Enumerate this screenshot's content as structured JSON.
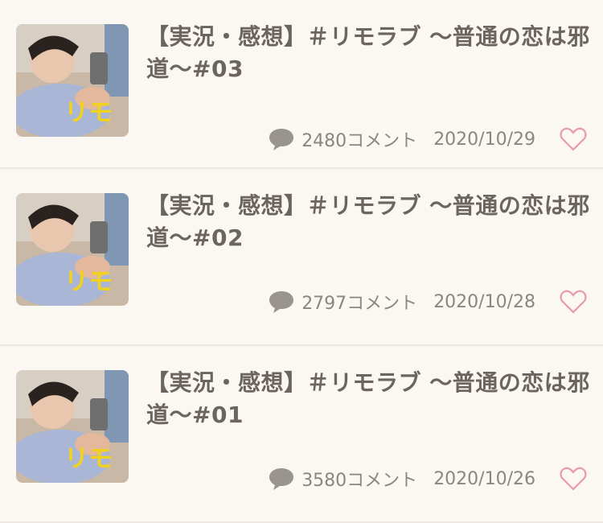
{
  "articles": [
    {
      "title": "【実況・感想】＃リモラブ 〜普通の恋は邪道〜#03",
      "comments": "2480コメント",
      "date": "2020/10/29",
      "thumb_text": "リモ"
    },
    {
      "title": "【実況・感想】＃リモラブ 〜普通の恋は邪道〜#02",
      "comments": "2797コメント",
      "date": "2020/10/28",
      "thumb_text": "リモ"
    },
    {
      "title": "【実況・感想】＃リモラブ 〜普通の恋は邪道〜#01",
      "comments": "3580コメント",
      "date": "2020/10/26",
      "thumb_text": "リモ"
    }
  ],
  "colors": {
    "background": "#fbf7f3",
    "title": "#6b6461",
    "meta": "#8c8582",
    "heart": "#e79aa8",
    "comment_icon": "#9a9491"
  }
}
